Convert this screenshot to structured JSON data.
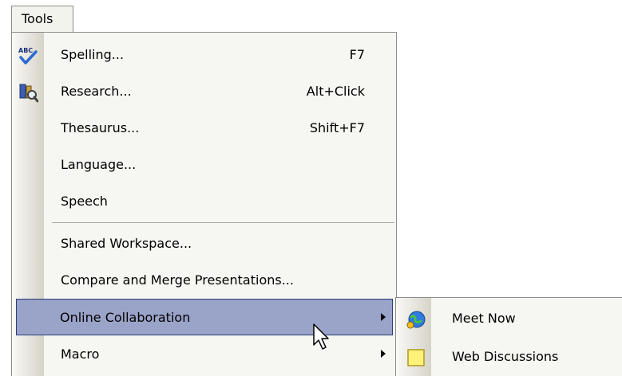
{
  "menubar": {
    "tools": "Tools"
  },
  "menu": {
    "items": [
      {
        "label": "Spelling...",
        "shortcut": "F7",
        "icon": "spelling-icon"
      },
      {
        "label": "Research...",
        "shortcut": "Alt+Click",
        "icon": "research-icon"
      },
      {
        "label": "Thesaurus...",
        "shortcut": "Shift+F7"
      },
      {
        "label": "Language..."
      },
      {
        "label": "Speech"
      },
      {
        "label": "Shared Workspace..."
      },
      {
        "label": "Compare and Merge Presentations..."
      },
      {
        "label": "Online Collaboration",
        "submenu": true,
        "highlighted": true
      },
      {
        "label": "Macro",
        "submenu": true
      }
    ]
  },
  "submenu": {
    "items": [
      {
        "label": "Meet Now",
        "icon": "meet-now-icon"
      },
      {
        "label": "Web Discussions",
        "icon": "web-discussions-icon"
      }
    ]
  },
  "colors": {
    "highlight": "#9aa3c8",
    "highlight_border": "#2b3b7a",
    "menu_bg": "#f6f6f2"
  }
}
